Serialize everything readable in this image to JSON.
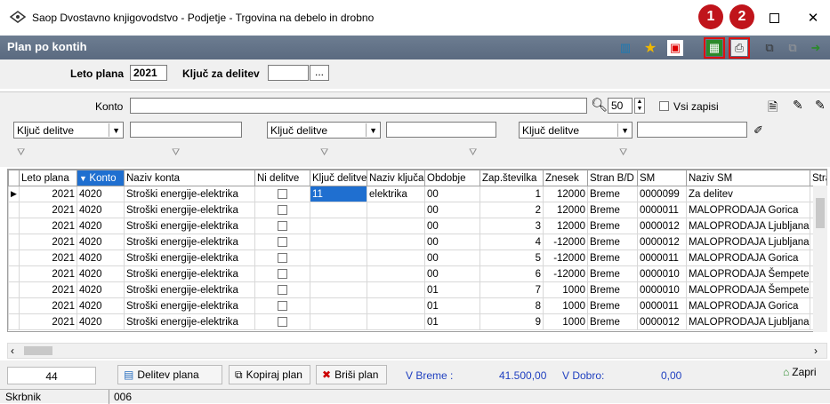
{
  "window": {
    "title": "Saop Dvostavno knjigovodstvo - Podjetje - Trgovina na debelo in drobno",
    "badge1": "1",
    "badge2": "2"
  },
  "header": {
    "title": "Plan po kontih"
  },
  "form": {
    "leto_label": "Leto plana",
    "leto_value": "2021",
    "kljuc_label": "Ključ za delitev",
    "kljuc_value": "",
    "browse": "..."
  },
  "filter": {
    "konto_label": "Konto",
    "konto_value": "",
    "count": "50",
    "vsi_label": "Vsi zapisi",
    "combos": [
      "Ključ delitve",
      "Ključ delitve",
      "Ključ delitve"
    ]
  },
  "table": {
    "headers": [
      "Leto plana",
      "Konto",
      "Naziv konta",
      "Ni delitve",
      "Ključ delitve",
      "Naziv ključa",
      "Obdobje",
      "Zap.številka",
      "Znesek",
      "Stran B/D",
      "SM",
      "Naziv SM",
      "Stra"
    ],
    "rows": [
      [
        "2021",
        "4020",
        "Stroški energije-elektrika",
        "",
        "11",
        "elektrika",
        "00",
        "1",
        "12000",
        "Breme",
        "0000099",
        "Za delitev"
      ],
      [
        "2021",
        "4020",
        "Stroški energije-elektrika",
        "",
        "",
        "",
        "00",
        "2",
        "12000",
        "Breme",
        "0000011",
        "MALOPRODAJA Gorica"
      ],
      [
        "2021",
        "4020",
        "Stroški energije-elektrika",
        "",
        "",
        "",
        "00",
        "3",
        "12000",
        "Breme",
        "0000012",
        "MALOPRODAJA Ljubljana"
      ],
      [
        "2021",
        "4020",
        "Stroški energije-elektrika",
        "",
        "",
        "",
        "00",
        "4",
        "-12000",
        "Breme",
        "0000012",
        "MALOPRODAJA Ljubljana"
      ],
      [
        "2021",
        "4020",
        "Stroški energije-elektrika",
        "",
        "",
        "",
        "00",
        "5",
        "-12000",
        "Breme",
        "0000011",
        "MALOPRODAJA Gorica"
      ],
      [
        "2021",
        "4020",
        "Stroški energije-elektrika",
        "",
        "",
        "",
        "00",
        "6",
        "-12000",
        "Breme",
        "0000010",
        "MALOPRODAJA Šempeter"
      ],
      [
        "2021",
        "4020",
        "Stroški energije-elektrika",
        "",
        "",
        "",
        "01",
        "7",
        "1000",
        "Breme",
        "0000010",
        "MALOPRODAJA Šempeter"
      ],
      [
        "2021",
        "4020",
        "Stroški energije-elektrika",
        "",
        "",
        "",
        "01",
        "8",
        "1000",
        "Breme",
        "0000011",
        "MALOPRODAJA Gorica"
      ],
      [
        "2021",
        "4020",
        "Stroški energije-elektrika",
        "",
        "",
        "",
        "01",
        "9",
        "1000",
        "Breme",
        "0000012",
        "MALOPRODAJA Ljubljana"
      ]
    ]
  },
  "footer": {
    "count": "44",
    "delitev": "Delitev plana",
    "kopiraj": "Kopiraj plan",
    "brisi": "Briši plan",
    "breme_label": "V Breme :",
    "breme_value": "41.500,00",
    "dobro_label": "V Dobro:",
    "dobro_value": "0,00",
    "zapri": "Zapri"
  },
  "status": {
    "user": "Skrbnik",
    "code": "006"
  }
}
